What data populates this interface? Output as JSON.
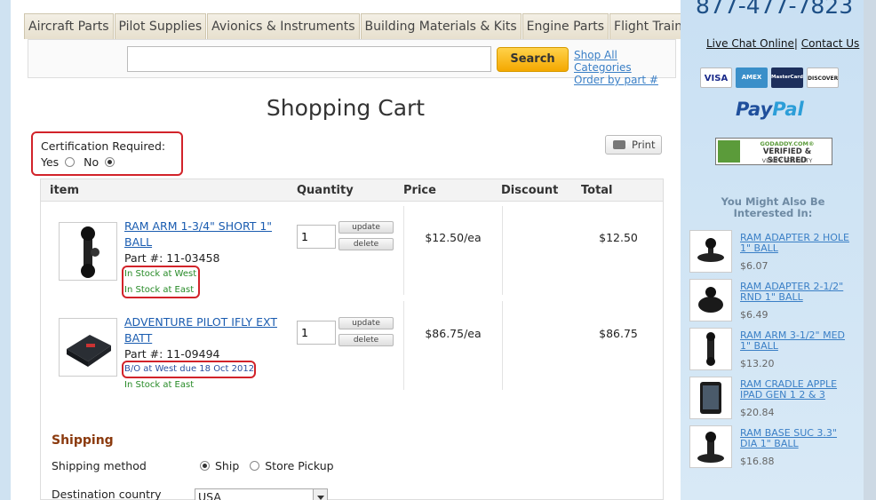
{
  "nav": {
    "tabs": [
      "Aircraft Parts",
      "Pilot Supplies",
      "Avionics & Instruments",
      "Building Materials & Kits",
      "Engine Parts",
      "Flight Training"
    ]
  },
  "search": {
    "value": "",
    "button_label": "Search",
    "link_all": "Shop All Categories",
    "link_part": "Order by part #"
  },
  "page_title": "Shopping Cart",
  "certification": {
    "label": "Certification Required:",
    "yes_label": "Yes",
    "no_label": "No",
    "selected": "No"
  },
  "print_label": "Print",
  "cart": {
    "headers": {
      "item": "item",
      "quantity": "Quantity",
      "price": "Price",
      "discount": "Discount",
      "total": "Total"
    },
    "update_label": "update",
    "delete_label": "delete",
    "items": [
      {
        "name": "RAM ARM 1-3/4\" SHORT 1\" BALL",
        "part": "Part #: 11-03458",
        "stock": [
          "In Stock at West",
          "In Stock at East"
        ],
        "qty": "1",
        "price": "$12.50/ea",
        "discount": "",
        "total": "$12.50"
      },
      {
        "name": "ADVENTURE PILOT IFLY EXT BATT",
        "part": "Part #: 11-09494",
        "stock": [
          "B/O at West due 18 Oct 2012",
          "In Stock at East"
        ],
        "qty": "1",
        "price": "$86.75/ea",
        "discount": "",
        "total": "$86.75"
      }
    ]
  },
  "shipping": {
    "heading": "Shipping",
    "method_label": "Shipping method",
    "ship_label": "Ship",
    "pickup_label": "Store Pickup",
    "selected": "Ship",
    "country_label": "Destination country",
    "country_value": "USA"
  },
  "sidebar": {
    "phone": "877-477-7823",
    "live_chat": "Live Chat Online",
    "separator": "|",
    "contact": "Contact Us",
    "cards": [
      "VISA",
      "AMEX",
      "MasterCard",
      "DISCOVER"
    ],
    "paypal_a": "Pay",
    "paypal_b": "Pal",
    "godaddy_line1": "GODADDY.COM®",
    "godaddy_line2": "VERIFIED & SECURED",
    "godaddy_line3": "VERIFY SECURITY",
    "ymal_title": "You Might Also Be Interested In:",
    "related": [
      {
        "name": "RAM ADAPTER 2 HOLE 1\" BALL",
        "price": "$6.07"
      },
      {
        "name": "RAM ADAPTER 2-1/2\" RND 1\" BALL",
        "price": "$6.49"
      },
      {
        "name": "RAM ARM 3-1/2\" MED 1\" BALL",
        "price": "$13.20"
      },
      {
        "name": "RAM CRADLE APPLE IPAD GEN 1 2 & 3",
        "price": "$20.84"
      },
      {
        "name": "RAM BASE SUC 3.3\" DIA 1\" BALL",
        "price": "$16.88"
      }
    ]
  }
}
